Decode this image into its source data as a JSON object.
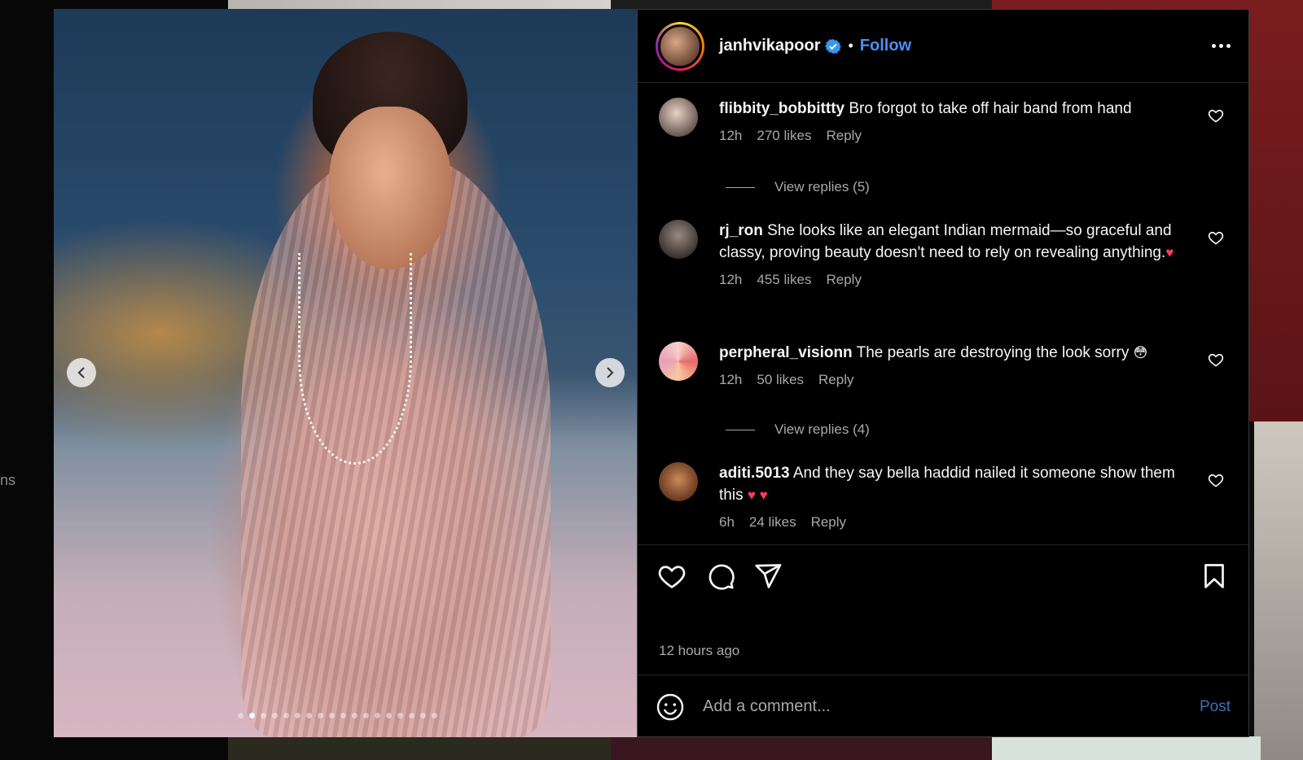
{
  "side_fragment": "ns",
  "post": {
    "username": "janhvikapoor",
    "follow_label": "Follow",
    "separator": "•",
    "timestamp": "12 hours ago",
    "carousel": {
      "total": 18,
      "active": 1
    }
  },
  "comments": [
    {
      "user": "flibbity_bobbittty",
      "text": "Bro forgot to take off hair band from hand",
      "time": "12h",
      "likes": "270 likes",
      "reply": "Reply",
      "view_replies": "View replies (5)"
    },
    {
      "user": "rj_ron",
      "text": "She looks like an elegant Indian mermaid—so graceful and classy, proving beauty doesn't need to rely on revealing anything.",
      "emoji": "♥",
      "time": "12h",
      "likes": "455 likes",
      "reply": "Reply"
    },
    {
      "user": "perpheral_visionn",
      "text": "The pearls are destroying the look sorry",
      "emoji": "😳",
      "time": "12h",
      "likes": "50 likes",
      "reply": "Reply",
      "view_replies": "View replies (4)"
    },
    {
      "user": "aditi.5013",
      "text": "And they say bella haddid nailed it someone show them this",
      "emoji": "♥ ♥",
      "time": "6h",
      "likes": "24 likes",
      "reply": "Reply"
    }
  ],
  "composer": {
    "placeholder": "Add a comment...",
    "post_label": "Post"
  },
  "colors": {
    "accent_blue": "#4a90f0",
    "heart_red": "#ff3b5c",
    "muted": "#a8a8a8"
  }
}
